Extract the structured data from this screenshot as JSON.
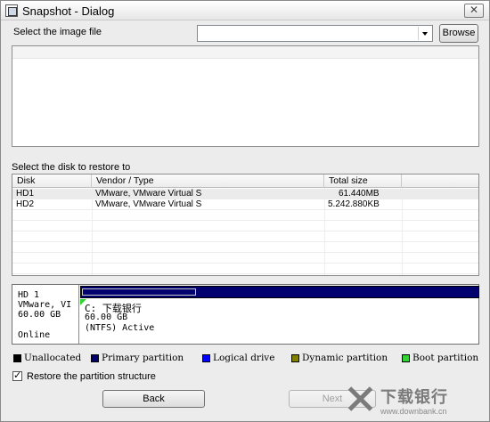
{
  "window": {
    "title": "Snapshot - Dialog",
    "close_glyph": "✕"
  },
  "image_file": {
    "label": "Select the image file",
    "value": "",
    "browse_label": "Browse"
  },
  "disk_list": {
    "label": "Select the disk to restore to",
    "columns": [
      "Disk",
      "Vendor / Type",
      "Total size"
    ],
    "rows": [
      {
        "disk": "HD1",
        "vendor": "VMware,  VMware Virtual S",
        "size": "61.440MB"
      },
      {
        "disk": "HD2",
        "vendor": "VMware,  VMware Virtual S",
        "size": "5.242.880KB"
      }
    ]
  },
  "disk_map": {
    "info": [
      "HD 1",
      "VMware,  VI",
      "60.00 GB",
      "",
      "Online"
    ],
    "partition": {
      "name": "C: 下载银行",
      "size": "60.00 GB",
      "fs": "(NTFS) Active"
    },
    "primary_fill": 1.0
  },
  "legend": [
    {
      "label": "Unallocated",
      "color": "#000000"
    },
    {
      "label": "Primary partition",
      "color": "#00006e"
    },
    {
      "label": "Logical drive",
      "color": "#0000ff"
    },
    {
      "label": "Dynamic partition",
      "color": "#808000"
    },
    {
      "label": "Boot partition",
      "color": "#35d235"
    }
  ],
  "restore_structure": {
    "label": "Restore the partition structure",
    "checked": true
  },
  "buttons": {
    "back": "Back",
    "next": "Next"
  },
  "watermark": {
    "text": "下载银行",
    "url": "www.downbank.cn"
  }
}
